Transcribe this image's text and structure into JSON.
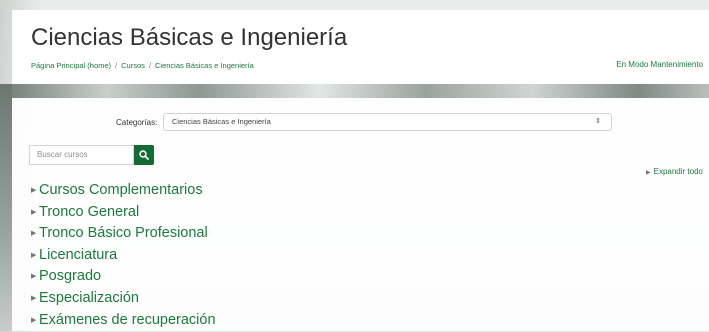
{
  "header": {
    "title": "Ciencias Básicas e Ingeniería",
    "breadcrumb": [
      "Página Principal (home)",
      "Cursos",
      "Ciencias Básicas e Ingeniería"
    ],
    "breadcrumb_separator": "/",
    "maintenance_link": "En Modo Mantenimiento"
  },
  "filter": {
    "label": "Categorías:",
    "selected": "Ciencias Básicas e Ingeniería"
  },
  "search": {
    "placeholder": "Buscar cursos",
    "button_icon": "search-icon"
  },
  "expand_all_label": "Expandir todo",
  "categories": [
    "Cursos Complementarios",
    "Tronco General",
    "Tronco Básico Profesional",
    "Licenciatura",
    "Posgrado",
    "Especialización",
    "Exámenes de recuperación"
  ],
  "colors": {
    "accent": "#1d7a3e",
    "button": "#146b35"
  }
}
